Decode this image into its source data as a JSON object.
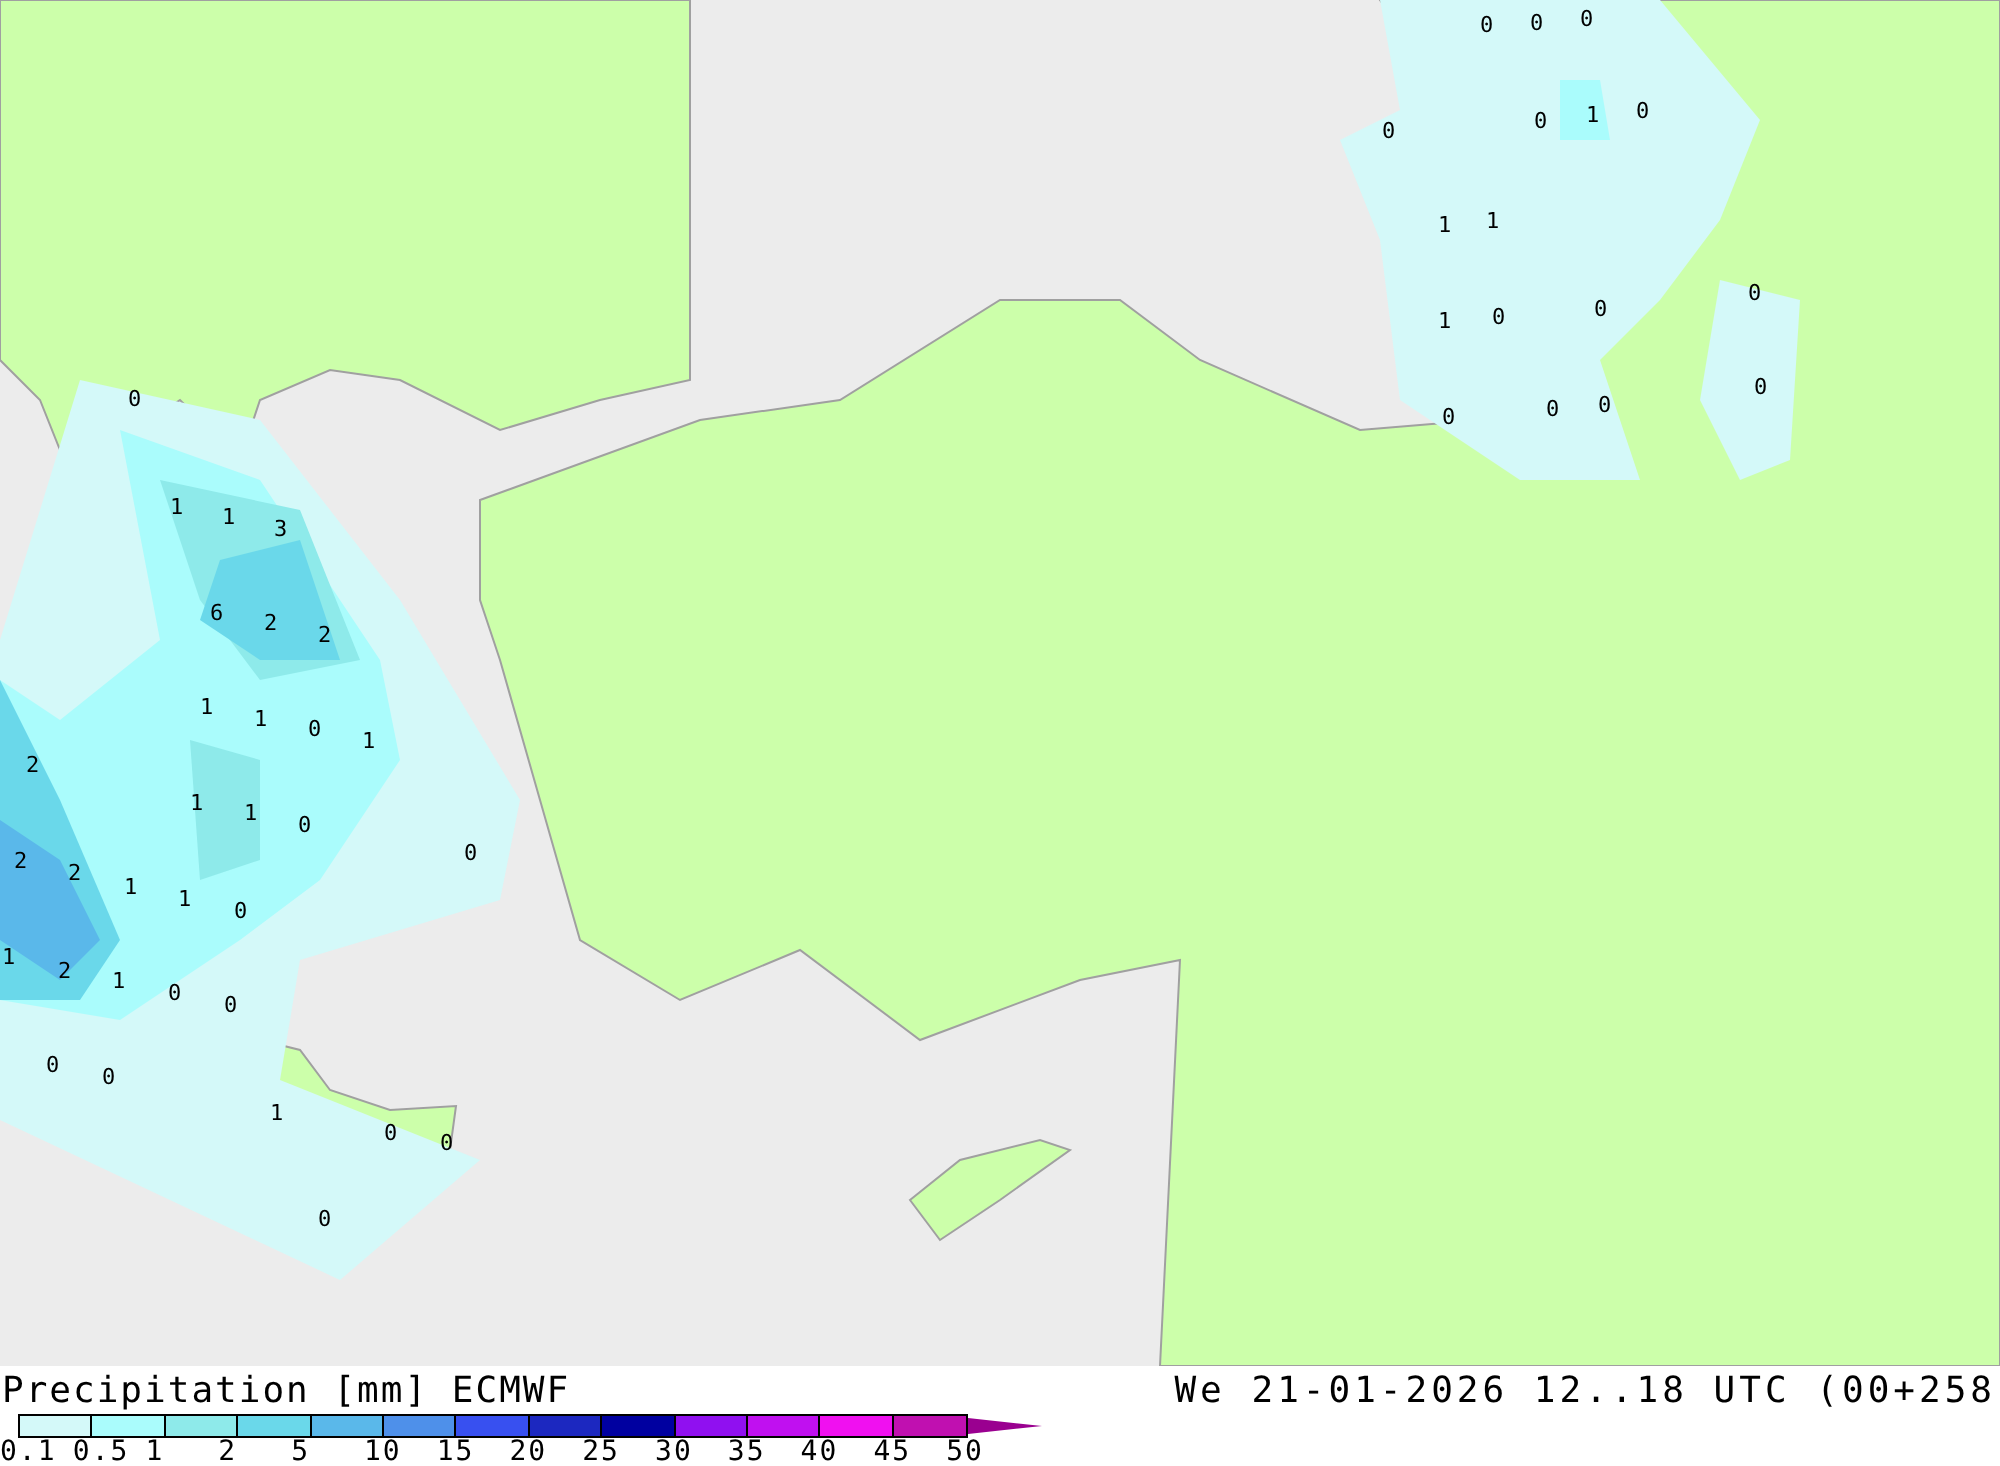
{
  "map": {
    "labels": [
      "0",
      "0",
      "0",
      "0",
      "1",
      "0",
      "0",
      "1",
      "1",
      "1",
      "0",
      "0",
      "0",
      "0",
      "0",
      "0",
      "0",
      "0",
      "1",
      "1",
      "3",
      "6",
      "2",
      "2",
      "1",
      "1",
      "0",
      "1",
      "2",
      "1",
      "1",
      "0",
      "0",
      "2",
      "2",
      "1",
      "1",
      "0",
      "1",
      "2",
      "1",
      "0",
      "0",
      "0",
      "0",
      "1",
      "0",
      "0",
      "0"
    ]
  },
  "legend": {
    "title": "Precipitation [mm] ECMWF",
    "date": "We 21-01-2026 12..18 UTC (00+258",
    "bins": [
      {
        "color": "#d4f9f9"
      },
      {
        "color": "#aafcfc"
      },
      {
        "color": "#8eeaea"
      },
      {
        "color": "#6ad8ea"
      },
      {
        "color": "#5ab8ea"
      },
      {
        "color": "#4e90ea"
      },
      {
        "color": "#3850f0"
      },
      {
        "color": "#1c28c0"
      },
      {
        "color": "#0000a0"
      },
      {
        "color": "#9010f0"
      },
      {
        "color": "#c010f0"
      },
      {
        "color": "#f010f0"
      },
      {
        "color": "#c010b0"
      }
    ],
    "overflow": {
      "color": "#9a0090"
    },
    "ticks": [
      "0.1",
      "0.5",
      "1",
      "2",
      "5",
      "10",
      "15",
      "20",
      "25",
      "30",
      "35",
      "40",
      "45",
      "50"
    ]
  }
}
